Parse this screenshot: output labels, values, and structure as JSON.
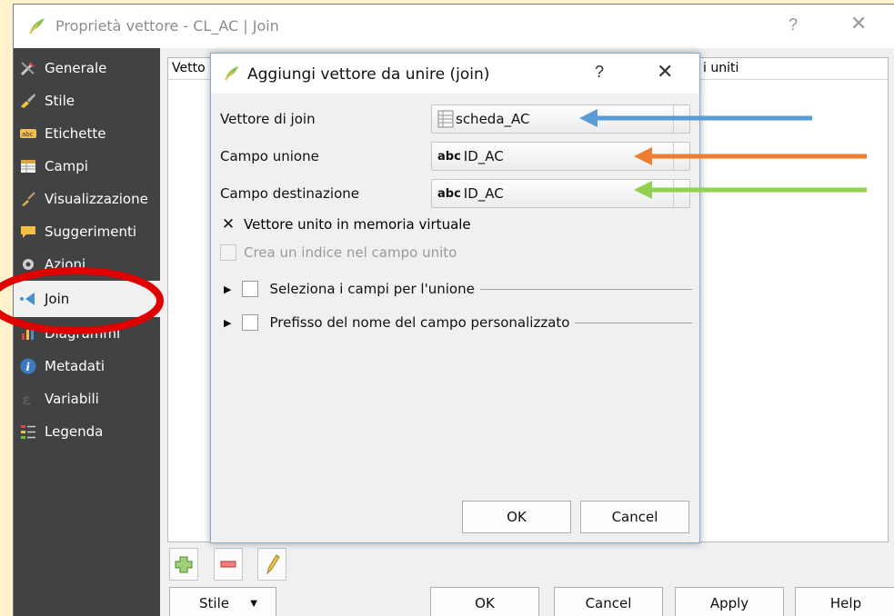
{
  "window": {
    "title": "Proprietà vettore - CL_AC | Join",
    "help_glyph": "?",
    "close_glyph": "✕"
  },
  "sidebar": {
    "items": [
      {
        "label": "Generale",
        "icon": "tools-icon"
      },
      {
        "label": "Stile",
        "icon": "paintbrush-icon"
      },
      {
        "label": "Etichette",
        "icon": "abc-label-icon"
      },
      {
        "label": "Campi",
        "icon": "table-icon"
      },
      {
        "label": "Visualizzazione",
        "icon": "brush-icon"
      },
      {
        "label": "Suggerimenti",
        "icon": "speech-bubble-icon"
      },
      {
        "label": "Azioni",
        "icon": "gear-icon"
      },
      {
        "label": "Join",
        "icon": "join-icon",
        "selected": true
      },
      {
        "label": "Diagrammi",
        "icon": "diagram-icon"
      },
      {
        "label": "Metadati",
        "icon": "info-icon"
      },
      {
        "label": "Variabili",
        "icon": "epsilon-icon"
      },
      {
        "label": "Legenda",
        "icon": "legend-icon"
      }
    ]
  },
  "table": {
    "col_vettore": "Vetto",
    "col_uniti": "i uniti"
  },
  "bottom": {
    "stile": "Stile",
    "ok": "OK",
    "cancel": "Cancel",
    "apply": "Apply",
    "help": "Help"
  },
  "dialog": {
    "title": "Aggiungi vettore da unire (join)",
    "help_glyph": "?",
    "close_glyph": "✕",
    "join_layer_label": "Vettore di join",
    "join_layer_value": "scheda_AC",
    "join_field_label": "Campo unione",
    "join_field_value": "ID_AC",
    "target_field_label": "Campo destinazione",
    "target_field_value": "ID_AC",
    "abc": "abc",
    "cache_label": "Vettore unito in memoria virtuale",
    "cache_checked": "✕",
    "index_label": "Crea un indice nel campo unito",
    "subset_label": "Seleziona i campi per l'unione",
    "prefix_label": "Prefisso del nome del campo personalizzato",
    "ok": "OK",
    "cancel": "Cancel"
  },
  "colors": {
    "background": "#fff2cc",
    "sidebar": "#404244",
    "arrow_blue": "#5b9bd5",
    "arrow_orange": "#ed7d31",
    "arrow_green": "#92d050",
    "highlight_ellipse": "#e00000"
  }
}
